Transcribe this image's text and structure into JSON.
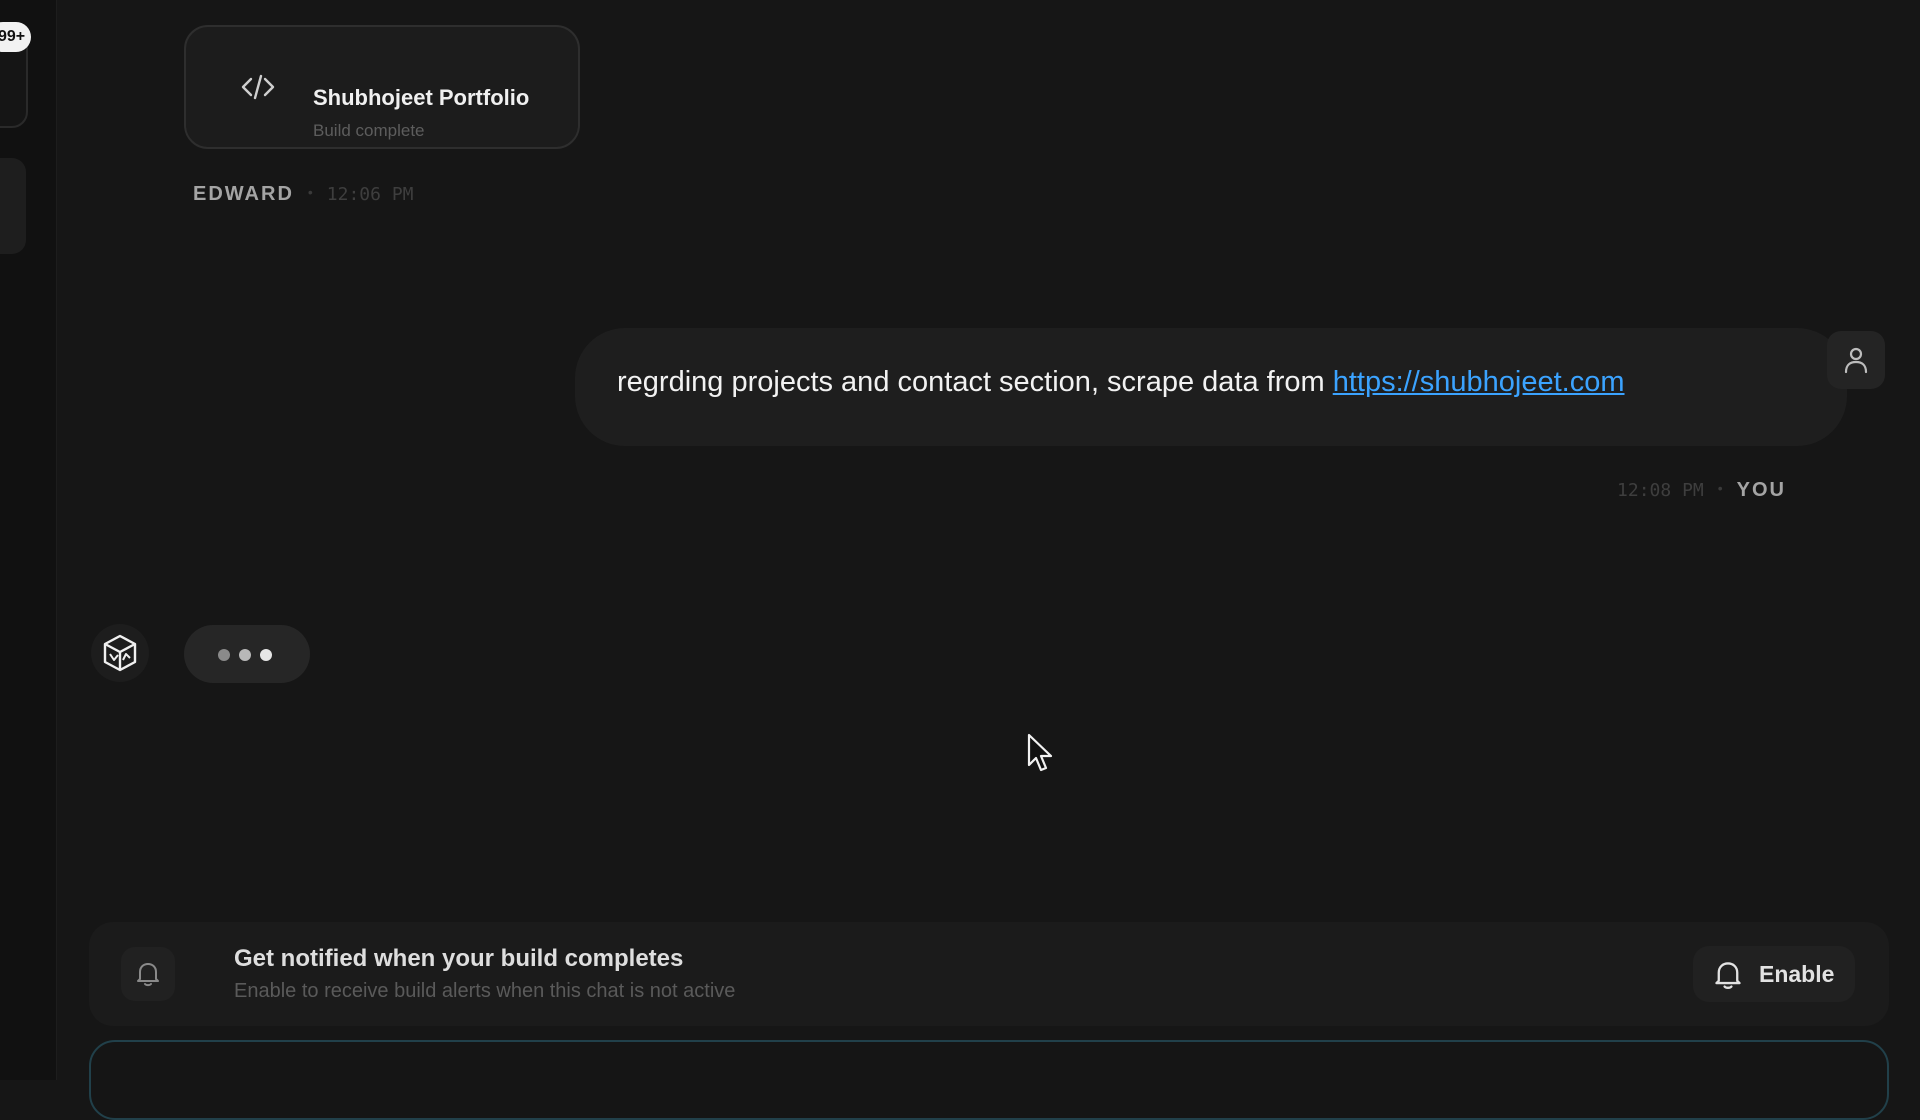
{
  "left_rail": {
    "badge": "99+"
  },
  "build_card": {
    "title": "Shubhojeet Portfolio",
    "subtitle": "Build complete",
    "icon": "code-icon"
  },
  "messages": [
    {
      "sender": "EDWARD",
      "time": "12:06 PM"
    },
    {
      "sender": "YOU",
      "time": "12:08 PM",
      "text": "regrding projects and contact section, scrape data from ",
      "link": "https://shubhojeet.com"
    }
  ],
  "typing_indicator": {
    "dot_colors": [
      "#8a8a8a",
      "#b8b8b8",
      "#e6e6e6"
    ]
  },
  "notification": {
    "title": "Get notified when your build completes",
    "subtitle": "Enable to receive build alerts when this chat is not active",
    "button_label": "Enable"
  },
  "colors": {
    "background": "#161616",
    "link": "#3ba3ff",
    "input_border": "#21404a"
  }
}
